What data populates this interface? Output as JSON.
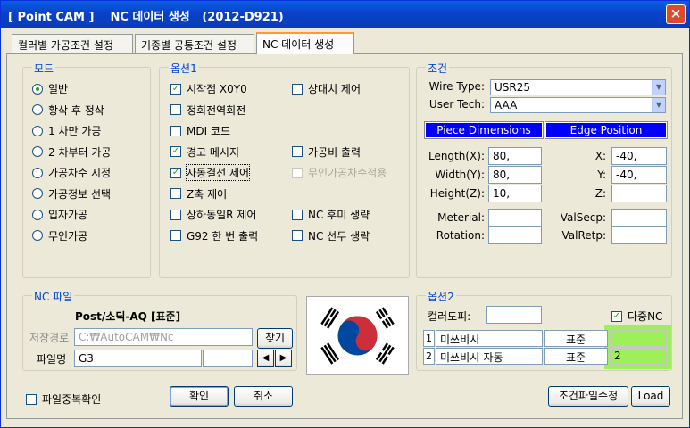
{
  "window": {
    "title": "[ Point CAM ]    NC 데이터 생성   (2012-D921)",
    "close_label": "×"
  },
  "tabs": [
    {
      "label": "컬러별 가공조건 설정"
    },
    {
      "label": "기종별 공통조건 설정"
    },
    {
      "label": "NC 데이터 생성",
      "active": true
    }
  ],
  "mode": {
    "label": "모드",
    "options": [
      {
        "label": "일반",
        "selected": true
      },
      {
        "label": "황삭 후 정삭",
        "selected": false
      },
      {
        "label": "1 차만 가공",
        "selected": false
      },
      {
        "label": "2 차부터 가공",
        "selected": false
      },
      {
        "label": "가공차수 지정",
        "selected": false
      },
      {
        "label": "가공정보 선택",
        "selected": false
      },
      {
        "label": "입자가공",
        "selected": false
      },
      {
        "label": "무인가공",
        "selected": false
      }
    ]
  },
  "option1": {
    "label": "옵션1",
    "left": [
      {
        "label": "시작점 X0Y0",
        "checked": true
      },
      {
        "label": "정회전역회전",
        "checked": false
      },
      {
        "label": "MDI 코드",
        "checked": false
      },
      {
        "label": "경고 메시지",
        "checked": true
      },
      {
        "label": "자동결선 제어",
        "checked": true
      },
      {
        "label": "Z축 제어",
        "checked": false
      },
      {
        "label": "상하동일R 제어",
        "checked": false
      },
      {
        "label": "G92 한 번 출력",
        "checked": false
      }
    ],
    "right": [
      {
        "label": "상대치 제어",
        "checked": false,
        "disabled": false
      },
      {
        "label": "가공비 출력",
        "checked": false,
        "disabled": false
      },
      {
        "label": "무인가공차수적용",
        "checked": false,
        "disabled": true
      },
      {
        "label": "NC 후미 생략",
        "checked": false,
        "disabled": false
      },
      {
        "label": "NC 선두 생략",
        "checked": false,
        "disabled": false
      }
    ]
  },
  "condition": {
    "label": "조건",
    "wire_type_label": "Wire Type:",
    "wire_type_value": "USR25",
    "user_tech_label": "User Tech:",
    "user_tech_value": "AAA",
    "piece_header": "Piece Dimensions",
    "edge_header": "Edge Position",
    "length_label": "Length(X):",
    "length_value": "80,",
    "width_label": "Width(Y):",
    "width_value": "80,",
    "height_label": "Height(Z):",
    "height_value": "10,",
    "x_label": "X:",
    "x_value": "-40,",
    "y_label": "Y:",
    "y_value": "-40,",
    "z_label": "Z:",
    "z_value": "",
    "material_label": "Meterial:",
    "material_value": "",
    "rotation_label": "Rotation:",
    "rotation_value": "",
    "valsecp_label": "ValSecp:",
    "valsecp_value": "",
    "valretp_label": "ValRetp:",
    "valretp_value": ""
  },
  "nc_file": {
    "label": "NC 파일",
    "post_name": "Post/소딕-AQ [표준]",
    "save_path_label": "저장경로",
    "save_path_value": "C:₩AutoCAM₩Nc",
    "browse_label": "찾기",
    "file_name_label": "파일명",
    "file_name_value": "G3",
    "file_ext_value": "",
    "prev_arrow": "◀",
    "next_arrow": "▶"
  },
  "option2": {
    "label": "옵션2",
    "color_label": "컬러도피:",
    "color_value": "",
    "multi_nc_label": "다중NC",
    "multi_nc_checked": true,
    "rows": [
      {
        "num": "1",
        "name": "미쓰비시",
        "type": "표준",
        "value": ""
      },
      {
        "num": "2",
        "name": "미쓰비시-자동",
        "type": "표준",
        "value": "2"
      }
    ]
  },
  "footer": {
    "dup_check_label": "파일중복확인",
    "confirm_label": "확인",
    "cancel_label": "취소",
    "edit_condition_label": "조건파일수정",
    "load_label": "Load"
  },
  "colors": {
    "title_bar": "#0842c9",
    "group_label": "#0046d5",
    "header_blue": "#0000ff",
    "highlight": "#9ef05a"
  }
}
